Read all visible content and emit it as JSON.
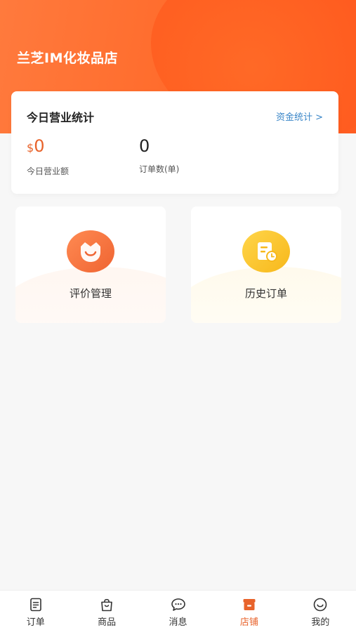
{
  "header": {
    "shop_name": "兰芝IM化妆品店"
  },
  "stats": {
    "title": "今日营业统计",
    "fund_link": "资金统计 >",
    "revenue": {
      "currency": "$",
      "value": "0",
      "label": "今日营业额"
    },
    "orders": {
      "value": "0",
      "label": "订单数(单)"
    }
  },
  "tiles": {
    "review": {
      "label": "评价管理",
      "icon": "smile-icon"
    },
    "history": {
      "label": "历史订单",
      "icon": "order-history-icon"
    }
  },
  "tabbar": {
    "items": [
      {
        "label": "订单",
        "icon": "order-list-icon",
        "active": false
      },
      {
        "label": "商品",
        "icon": "shopping-bag-icon",
        "active": false
      },
      {
        "label": "消息",
        "icon": "chat-bubble-icon",
        "active": false
      },
      {
        "label": "店铺",
        "icon": "store-icon",
        "active": true
      },
      {
        "label": "我的",
        "icon": "profile-smile-icon",
        "active": false
      }
    ]
  },
  "colors": {
    "brand_orange": "#ff6a2a",
    "accent_text": "#e8632b",
    "link_blue": "#3a86c8",
    "history_yellow": "#f7b81b"
  }
}
